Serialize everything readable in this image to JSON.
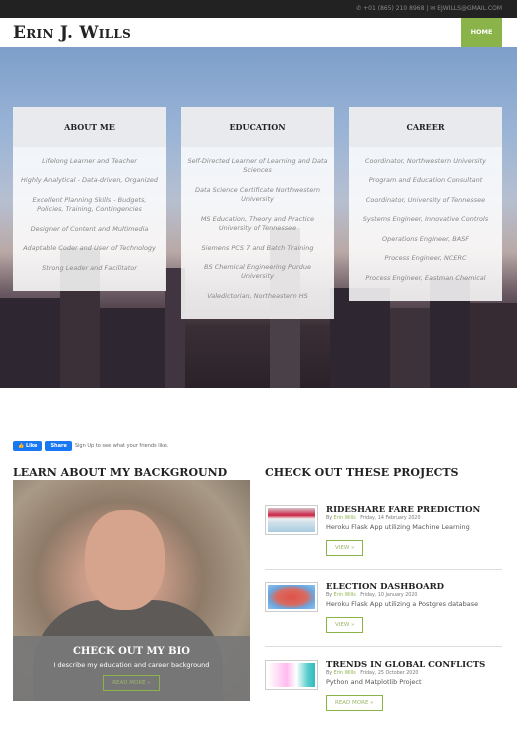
{
  "topbar": {
    "phone": "+01 (865) 210 8968",
    "email": "EJWILLS@GMAIL.COM"
  },
  "header": {
    "logo": "Erin J. Wills",
    "nav": {
      "home": "HOME"
    }
  },
  "hero": {
    "cards": [
      {
        "title": "ABOUT ME",
        "items": [
          "Lifelong Learner and Teacher",
          "Highly Analytical - Data-driven, Organized",
          "Excellent Planning Skills - Budgets, Policies, Training, Contingencies",
          "Designer of Content and Multimedia",
          "Adaptable Coder and User of Technology",
          "Strong Leader and Facilitator"
        ]
      },
      {
        "title": "EDUCATION",
        "items": [
          "Self-Directed Learner of Learning and Data Sciences",
          "Data Science Certificate Northwestern University",
          "MS Education, Theory and Practice University of Tennessee",
          "Siemens PCS 7 and Batch Training",
          "BS Chemical Engineering Purdue University",
          "Valedictorian, Northeastern HS"
        ]
      },
      {
        "title": "CAREER",
        "items": [
          "Coordinator, Northwestern University",
          "Program and Education Consultant",
          "Coordinator, University of Tennessee",
          "Systems Engineer, Innovative Controls",
          "Operations Engineer, BASF",
          "Process Engineer, NCERC",
          "Process Engineer, Eastman Chemical"
        ]
      }
    ]
  },
  "social": {
    "like": "Like",
    "share": "Share",
    "text": "Sign Up to see what your friends like."
  },
  "background": {
    "heading": "LEARN ABOUT MY BACKGROUND",
    "bio_title": "CHECK OUT MY BIO",
    "bio_text": "I describe my education and career background",
    "bio_button": "READ MORE »"
  },
  "projects": {
    "heading": "CHECK OUT THESE PROJECTS",
    "items": [
      {
        "title": "RIDESHARE FARE PREDICTION",
        "by": "By",
        "author": "Erin Wills",
        "date": "Friday, 14 February 2020",
        "desc": "Heroku Flask App utilizing Machine Learning",
        "button": "VIEW »"
      },
      {
        "title": "ELECTION DASHBOARD",
        "by": "By",
        "author": "Erin Wills",
        "date": "Friday, 10 January 2020",
        "desc": "Heroku Flask App utilizing a Postgres database",
        "button": "VIEW »"
      },
      {
        "title": "TRENDS IN GLOBAL CONFLICTS",
        "by": "By",
        "author": "Erin Wills",
        "date": "Friday, 25 October 2020",
        "desc": "Python and Matplotlib Project",
        "button": "READ MORE »"
      }
    ]
  },
  "colors": {
    "accent": "#8ab44a",
    "topbar": "#222222"
  }
}
